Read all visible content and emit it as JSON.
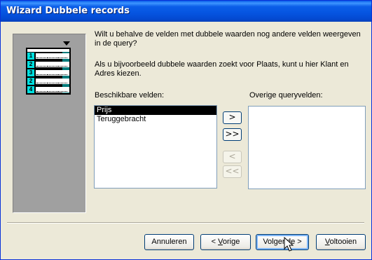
{
  "window": {
    "title": "Wizard Dubbele records"
  },
  "illustration": {
    "rows": [
      "1",
      "2",
      "3",
      "2",
      "4"
    ]
  },
  "text": {
    "intro": "Wilt u behalve de velden met dubbele waarden nog andere velden weergeven in de query?",
    "example": "Als u bijvoorbeeld dubbele waarden zoekt voor Plaats, kunt u hier Klant en Adres kiezen."
  },
  "available": {
    "label": "Beschikbare velden:",
    "items": [
      "Prijs",
      "Teruggebracht"
    ],
    "selected": "Prijs"
  },
  "other": {
    "label": "Overige queryvelden:",
    "items": []
  },
  "move_buttons": {
    "add_one": ">",
    "add_all": ">>",
    "remove_one": "<",
    "remove_all": "<<"
  },
  "buttons": {
    "cancel": "Annuleren",
    "back_prefix": "< ",
    "back_key": "V",
    "back_rest": "orige",
    "next_text": "Volgende >",
    "finish_key": "V",
    "finish_rest": "oltooien"
  },
  "colors": {
    "title_bar": "#0554e0",
    "illus_accent": "#00e0e0",
    "selection": "#000000"
  }
}
